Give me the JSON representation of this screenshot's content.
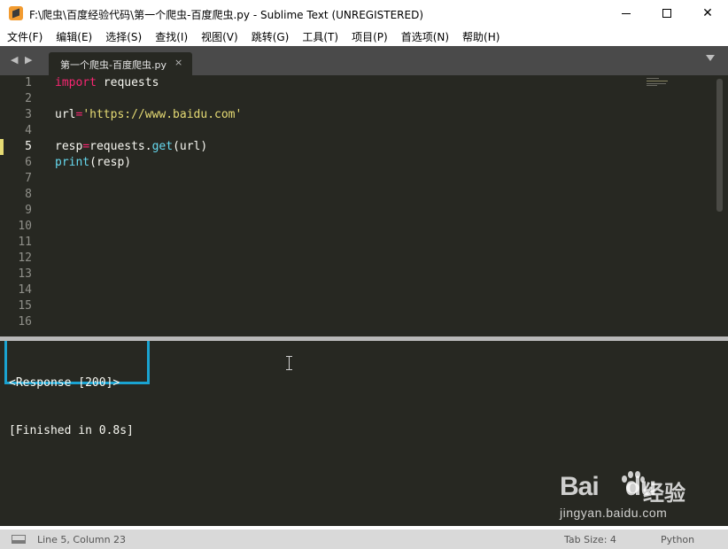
{
  "window": {
    "title": "F:\\爬虫\\百度经验代码\\第一个爬虫-百度爬虫.py - Sublime Text (UNREGISTERED)"
  },
  "menu": {
    "items": [
      "文件(F)",
      "编辑(E)",
      "选择(S)",
      "查找(I)",
      "视图(V)",
      "跳转(G)",
      "工具(T)",
      "项目(P)",
      "首选项(N)",
      "帮助(H)"
    ]
  },
  "tabs": {
    "nav_arrows": "◀ ▶",
    "items": [
      {
        "label": "第一个爬虫-百度爬虫.py",
        "close": "×"
      }
    ]
  },
  "editor": {
    "active_line": 5,
    "line_numbers": [
      "1",
      "2",
      "3",
      "4",
      "5",
      "6",
      "7",
      "8",
      "9",
      "10",
      "11",
      "12",
      "13",
      "14",
      "15",
      "16"
    ],
    "code": {
      "l1_kw": "import",
      "l1_rest": " requests",
      "l3_var": "url",
      "l3_op": "=",
      "l3_str": "'https://www.baidu.com'",
      "l5_var": "resp",
      "l5_op": "=",
      "l5_obj": "requests.",
      "l5_fn": "get",
      "l5_args": "(url)",
      "l6_fn": "print",
      "l6_args": "(resp)"
    }
  },
  "output": {
    "lines": [
      "<Response [200]>",
      "[Finished in 0.8s]"
    ]
  },
  "watermark": {
    "logo": "Bai",
    "logo_tail": "du",
    "cn": "经验",
    "url": "jingyan.baidu.com"
  },
  "status": {
    "position": "Line 5, Column 23",
    "tab_size": "Tab Size: 4",
    "syntax": "Python"
  },
  "colors": {
    "editor_bg": "#272822",
    "keyword": "#f92672",
    "function": "#66d9ef",
    "string": "#e6db74",
    "highlight_box": "#1aa3d1"
  }
}
